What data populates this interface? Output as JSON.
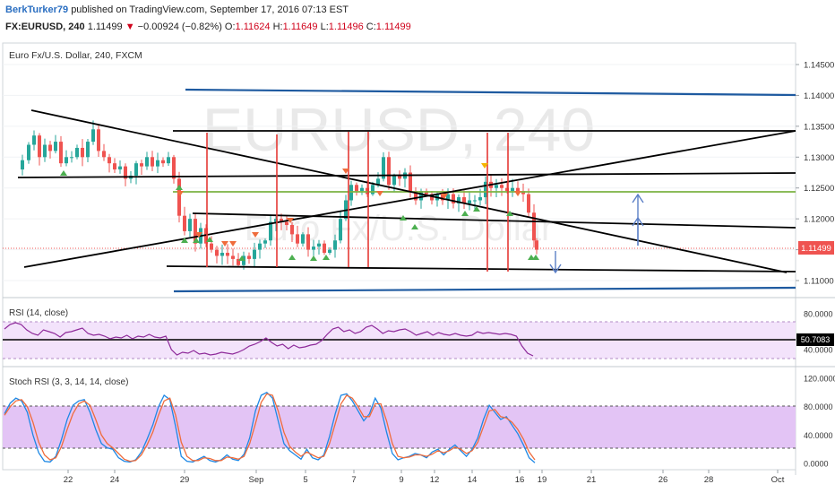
{
  "header": {
    "author": "BerkTurker79",
    "published_text": "published on TradingView.com, September 17, 2016 07:13 EST",
    "symbol": "FX:EURUSD, 240",
    "last": "1.11499",
    "change": "−0.00924 (−0.82%)",
    "o_label": "O:",
    "o_value": "1.11624",
    "h_label": "H:",
    "h_value": "1.11649",
    "l_label": "L:",
    "l_value": "1.11496",
    "c_label": "C:",
    "c_value": "1.11499"
  },
  "colors": {
    "bull": "#26a69a",
    "bear": "#ef5350",
    "trendline": "#000000",
    "channel": "#1e5aa0",
    "green_level": "#7cb342",
    "red_vertical": "#e53935",
    "rsi_line": "#8e2a9a",
    "rsi_band": "#f3e3fb",
    "stoch_band": "#e3c4f5",
    "stoch_k": "#1e88e5",
    "stoch_d": "#ef6c3c",
    "arrow": "#5b7fc6",
    "watermark": "#e9e9e9"
  },
  "watermark": {
    "main": "EURUSD, 240",
    "sub": "Euro Fx/U.S. Dollar"
  },
  "chart_data": [
    {
      "type": "candlestick",
      "title": "Euro Fx/U.S. Dollar, 240, FXCM",
      "ylim": [
        1.1085,
        1.1475
      ],
      "y_ticks": [
        "1.11000",
        "1.11500",
        "1.12000",
        "1.12500",
        "1.13000",
        "1.13500",
        "1.14000",
        "1.14500"
      ],
      "last_price_label": "1.11499",
      "x_tick_labels": [
        "22",
        "24",
        "29",
        "Sep",
        "5",
        "7",
        "9",
        "12",
        "14",
        "16",
        "19",
        "21",
        "26",
        "28",
        "Oct"
      ],
      "close_path": [
        [
          18,
          1.128
        ],
        [
          25,
          1.1295
        ],
        [
          32,
          1.132
        ],
        [
          38,
          1.1335
        ],
        [
          44,
          1.13
        ],
        [
          50,
          1.132
        ],
        [
          56,
          1.131
        ],
        [
          62,
          1.1325
        ],
        [
          68,
          1.129
        ],
        [
          74,
          1.13
        ],
        [
          80,
          1.13
        ],
        [
          86,
          1.1315
        ],
        [
          92,
          1.13
        ],
        [
          98,
          1.1325
        ],
        [
          104,
          1.1345
        ],
        [
          110,
          1.131
        ],
        [
          116,
          1.13
        ],
        [
          122,
          1.129
        ],
        [
          128,
          1.128
        ],
        [
          134,
          1.1285
        ],
        [
          140,
          1.1265
        ],
        [
          146,
          1.127
        ],
        [
          152,
          1.129
        ],
        [
          158,
          1.1285
        ],
        [
          164,
          1.13
        ],
        [
          170,
          1.1285
        ],
        [
          176,
          1.1295
        ],
        [
          182,
          1.129
        ],
        [
          188,
          1.13
        ],
        [
          194,
          1.1265
        ],
        [
          200,
          1.1205
        ],
        [
          206,
          1.118
        ],
        [
          212,
          1.12
        ],
        [
          218,
          1.116
        ],
        [
          224,
          1.1185
        ],
        [
          230,
          1.116
        ],
        [
          236,
          1.115
        ],
        [
          242,
          1.114
        ],
        [
          248,
          1.1145
        ],
        [
          254,
          1.114
        ],
        [
          260,
          1.1135
        ],
        [
          266,
          1.1125
        ],
        [
          272,
          1.114
        ],
        [
          278,
          1.1135
        ],
        [
          284,
          1.115
        ],
        [
          290,
          1.116
        ],
        [
          296,
          1.1165
        ],
        [
          302,
          1.1195
        ],
        [
          308,
          1.12
        ],
        [
          314,
          1.1195
        ],
        [
          320,
          1.119
        ],
        [
          326,
          1.1175
        ],
        [
          332,
          1.116
        ],
        [
          338,
          1.1175
        ],
        [
          344,
          1.115
        ],
        [
          350,
          1.1155
        ],
        [
          356,
          1.116
        ],
        [
          362,
          1.1145
        ],
        [
          368,
          1.115
        ],
        [
          374,
          1.1165
        ],
        [
          380,
          1.12
        ],
        [
          386,
          1.123
        ],
        [
          392,
          1.1255
        ],
        [
          398,
          1.1245
        ],
        [
          404,
          1.125
        ],
        [
          410,
          1.124
        ],
        [
          416,
          1.1255
        ],
        [
          422,
          1.1265
        ],
        [
          428,
          1.13
        ],
        [
          434,
          1.1255
        ],
        [
          440,
          1.127
        ],
        [
          446,
          1.1265
        ],
        [
          452,
          1.1275
        ],
        [
          458,
          1.1245
        ],
        [
          464,
          1.123
        ],
        [
          470,
          1.1245
        ],
        [
          476,
          1.124
        ],
        [
          482,
          1.123
        ],
        [
          488,
          1.124
        ],
        [
          494,
          1.123
        ],
        [
          500,
          1.124
        ],
        [
          506,
          1.1225
        ],
        [
          512,
          1.1235
        ],
        [
          518,
          1.1225
        ],
        [
          524,
          1.123
        ],
        [
          530,
          1.123
        ],
        [
          536,
          1.1235
        ],
        [
          542,
          1.126
        ],
        [
          548,
          1.125
        ],
        [
          554,
          1.1255
        ],
        [
          560,
          1.125
        ],
        [
          566,
          1.1245
        ],
        [
          572,
          1.125
        ],
        [
          578,
          1.1245
        ],
        [
          584,
          1.124
        ],
        [
          590,
          1.121
        ],
        [
          596,
          1.1165
        ],
        [
          599,
          1.115
        ]
      ],
      "horizontal_levels": [
        1.1342,
        1.12725,
        1.1265,
        1.1243
      ],
      "annotations": [
        "trend lines",
        "channel lines",
        "fractal triangles",
        "projection arrows"
      ]
    },
    {
      "type": "line",
      "title": "RSI (14, close)",
      "ylim": [
        30,
        85
      ],
      "y_ticks": [
        "40.0000",
        "80.0000"
      ],
      "last_value_label": "50.7083",
      "band": [
        30,
        70
      ],
      "mid": 50,
      "values": [
        63,
        68,
        70,
        68,
        62,
        58,
        56,
        62,
        60,
        58,
        54,
        59,
        60,
        62,
        64,
        58,
        56,
        57,
        55,
        52,
        54,
        53,
        56,
        52,
        55,
        54,
        57,
        54,
        53,
        55,
        40,
        34,
        37,
        36,
        39,
        35,
        36,
        34,
        35,
        37,
        36,
        35,
        37,
        40,
        44,
        46,
        49,
        53,
        48,
        44,
        46,
        41,
        45,
        42,
        43,
        45,
        46,
        50,
        57,
        63,
        65,
        60,
        62,
        58,
        60,
        65,
        67,
        63,
        58,
        61,
        60,
        62,
        63,
        60,
        56,
        58,
        60,
        56,
        59,
        57,
        56,
        58,
        56,
        55,
        56,
        60,
        58,
        59,
        58,
        57,
        58,
        57,
        55,
        44,
        36,
        33
      ]
    },
    {
      "type": "line",
      "title": "Stoch RSI (3, 3, 14, 14, close)",
      "ylim": [
        -8,
        125
      ],
      "y_ticks": [
        "0.0000",
        "40.0000",
        "80.0000",
        "120.0000"
      ],
      "band": [
        20,
        80
      ],
      "series": [
        {
          "name": "K",
          "values": [
            70,
            85,
            92,
            88,
            72,
            40,
            15,
            3,
            2,
            10,
            34,
            62,
            82,
            88,
            90,
            72,
            48,
            28,
            22,
            20,
            8,
            3,
            2,
            5,
            16,
            34,
            54,
            80,
            96,
            90,
            52,
            10,
            3,
            2,
            6,
            10,
            4,
            2,
            5,
            12,
            6,
            4,
            13,
            36,
            74,
            96,
            100,
            92,
            60,
            28,
            18,
            12,
            6,
            20,
            8,
            5,
            12,
            38,
            70,
            96,
            98,
            88,
            74,
            60,
            70,
            92,
            78,
            44,
            14,
            5,
            8,
            10,
            14,
            12,
            8,
            16,
            20,
            12,
            20,
            26,
            18,
            10,
            20,
            36,
            62,
            82,
            72,
            62,
            66,
            54,
            42,
            26,
            8,
            1
          ]
        },
        {
          "name": "D",
          "values": [
            68,
            80,
            88,
            90,
            80,
            58,
            30,
            12,
            5,
            8,
            24,
            48,
            70,
            84,
            88,
            82,
            62,
            40,
            28,
            22,
            14,
            6,
            3,
            4,
            12,
            26,
            44,
            68,
            88,
            92,
            68,
            30,
            10,
            4,
            4,
            8,
            7,
            4,
            4,
            9,
            8,
            6,
            10,
            28,
            56,
            86,
            98,
            96,
            74,
            44,
            24,
            16,
            10,
            16,
            12,
            8,
            10,
            28,
            56,
            84,
            96,
            92,
            80,
            66,
            66,
            84,
            84,
            60,
            28,
            10,
            8,
            9,
            12,
            12,
            10,
            13,
            18,
            15,
            18,
            23,
            20,
            14,
            18,
            30,
            52,
            74,
            76,
            66,
            64,
            58,
            48,
            34,
            16,
            5
          ]
        }
      ]
    }
  ]
}
